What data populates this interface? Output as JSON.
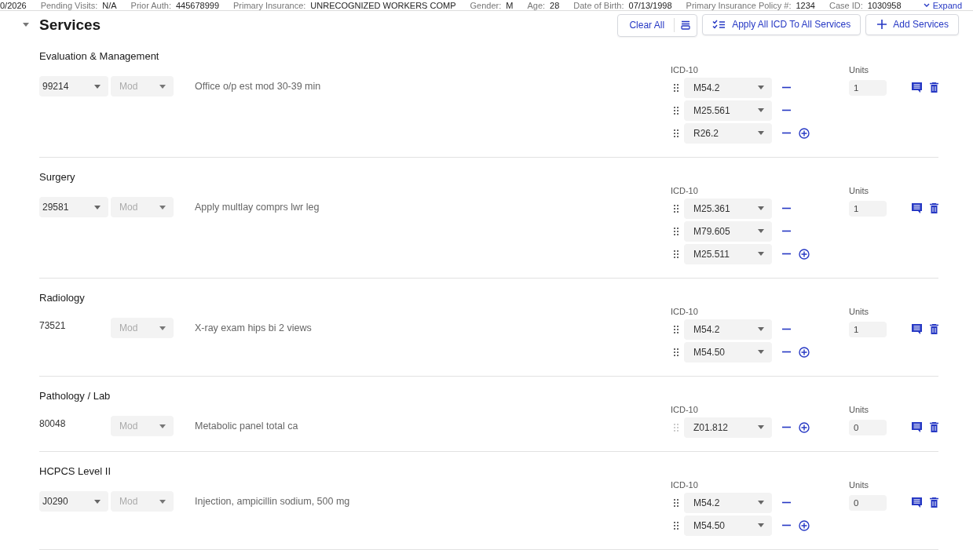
{
  "info_bar": {
    "items": [
      {
        "value": "0/2026"
      },
      {
        "label": "Pending Visits:",
        "value": "N/A"
      },
      {
        "label": "Prior Auth:",
        "value": "445678999"
      },
      {
        "label": "Primary Insurance:",
        "value": "UNRECOGNIZED WORKERS COMP"
      },
      {
        "label": "Gender:",
        "value": "M"
      },
      {
        "label": "Age:",
        "value": "28"
      },
      {
        "label": "Date of Birth:",
        "value": "07/13/1998"
      },
      {
        "label": "Primary Insurance Policy #:",
        "value": "1234"
      },
      {
        "label": "Case ID:",
        "value": "1030958"
      }
    ],
    "expand_link": "Expand"
  },
  "services": {
    "title": "Services",
    "expanded": true,
    "toolbar": {
      "clear_all": "Clear All",
      "apply_all": "Apply All ICD To All Services",
      "add": "Add Services"
    },
    "sections": [
      {
        "title": "Evaluation & Management",
        "code": {
          "kind": "select",
          "value": "99214"
        },
        "modifier": {
          "placeholder": "Mod"
        },
        "description": "Office o/p est mod 30-39 min",
        "icd_label": "ICD-10",
        "units_label": "Units",
        "units": "1",
        "icd": [
          {
            "code": "M54.2",
            "draggable": true
          },
          {
            "code": "M25.561",
            "draggable": true
          },
          {
            "code": "R26.2",
            "draggable": true
          }
        ]
      },
      {
        "title": "Surgery",
        "code": {
          "kind": "select",
          "value": "29581"
        },
        "modifier": {
          "placeholder": "Mod"
        },
        "description": "Apply multlay comprs lwr leg",
        "icd_label": "ICD-10",
        "units_label": "Units",
        "units": "1",
        "icd": [
          {
            "code": "M25.361",
            "draggable": true
          },
          {
            "code": "M79.605",
            "draggable": true
          },
          {
            "code": "M25.511",
            "draggable": true
          }
        ]
      },
      {
        "title": "Radiology",
        "code": {
          "kind": "text",
          "value": "73521"
        },
        "modifier": {
          "placeholder": "Mod"
        },
        "description": "X-ray exam hips bi 2 views",
        "icd_label": "ICD-10",
        "units_label": "Units",
        "units": "1",
        "icd": [
          {
            "code": "M54.2",
            "draggable": true
          },
          {
            "code": "M54.50",
            "draggable": true
          }
        ]
      },
      {
        "title": "Pathology / Lab",
        "code": {
          "kind": "text",
          "value": "80048"
        },
        "modifier": {
          "placeholder": "Mod"
        },
        "description": "Metabolic panel total ca",
        "icd_label": "ICD-10",
        "units_label": "Units",
        "units": "0",
        "icd": [
          {
            "code": "Z01.812",
            "draggable": false
          }
        ]
      },
      {
        "title": "HCPCS Level II",
        "code": {
          "kind": "select",
          "value": "J0290"
        },
        "modifier": {
          "placeholder": "Mod"
        },
        "description": "Injection, ampicillin sodium, 500 mg",
        "icd_label": "ICD-10",
        "units_label": "Units",
        "units": "0",
        "icd": [
          {
            "code": "M54.2",
            "draggable": true
          },
          {
            "code": "M54.50",
            "draggable": true
          }
        ]
      }
    ]
  }
}
